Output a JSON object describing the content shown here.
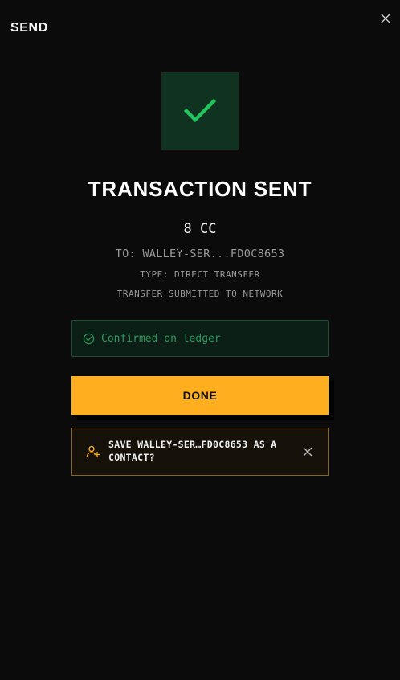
{
  "header": {
    "title": "SEND"
  },
  "icons": {
    "close": "close-icon",
    "success": "check-icon",
    "confirmed": "check-circle-icon",
    "contact": "user-plus-icon",
    "dismiss": "close-icon"
  },
  "colors": {
    "background": "#0b0b0b",
    "success_green": "#22c55e",
    "accent_orange": "#ffae1f"
  },
  "result": {
    "title": "TRANSACTION SENT",
    "amount": "8 CC",
    "recipient": "TO: WALLEY-SER...FD0C8653",
    "type": "TYPE: DIRECT TRANSFER",
    "note": "TRANSFER SUBMITTED TO NETWORK"
  },
  "ledger": {
    "status_label": "Confirmed on ledger"
  },
  "actions": {
    "done_label": "DONE"
  },
  "contact_prompt": {
    "text": "SAVE WALLEY-SER…FD0C8653 AS A CONTACT?"
  }
}
